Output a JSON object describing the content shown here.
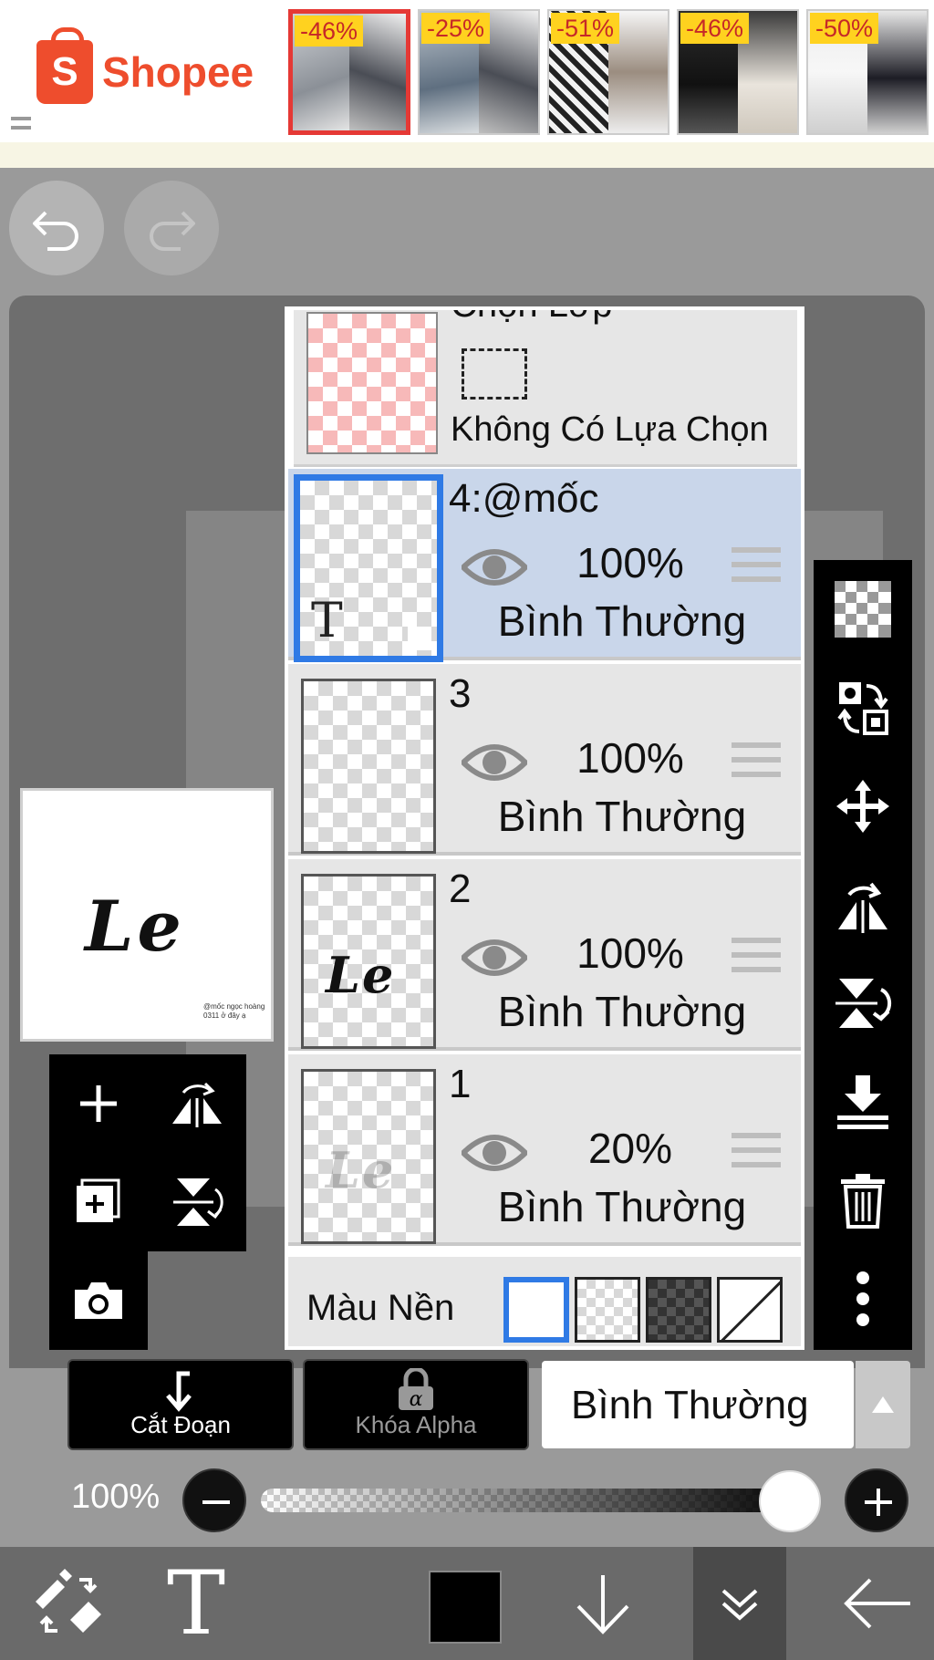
{
  "ad": {
    "brand": "Shopee",
    "products": [
      {
        "discount": "-46%"
      },
      {
        "discount": "-25%"
      },
      {
        "discount": "-51%"
      },
      {
        "discount": "-46%"
      },
      {
        "discount": "-50%"
      }
    ]
  },
  "preview": {
    "artwork_text": "Le",
    "tiny_text": "@mốc ngọc hoàng 0311 ở đây ạ"
  },
  "selection": {
    "title": "Chọn Lớp",
    "status": "Không Có Lựa Chọn"
  },
  "layers": [
    {
      "name": "4:@mốc",
      "opacity": "100%",
      "mode": "Bình Thường",
      "active": true,
      "content": "text"
    },
    {
      "name": "3",
      "opacity": "100%",
      "mode": "Bình Thường",
      "active": false,
      "content": "empty"
    },
    {
      "name": "2",
      "opacity": "100%",
      "mode": "Bình Thường",
      "active": false,
      "content": "script"
    },
    {
      "name": "1",
      "opacity": "20%",
      "mode": "Bình Thường",
      "active": false,
      "content": "script-faint"
    }
  ],
  "layer_thumb": {
    "text_icon": "T",
    "script_text": "Le"
  },
  "background": {
    "label": "Màu Nền",
    "options": [
      "white",
      "transparent",
      "dark-checker",
      "none"
    ],
    "selected": "white"
  },
  "buttons": {
    "clipping": "Cắt Đoạn",
    "alpha_lock": "Khóa Alpha"
  },
  "blend_mode": "Bình Thường",
  "opacity": {
    "label": "100%",
    "value": 1.0
  },
  "bottom_bar": {
    "text_tool": "T"
  },
  "colors": {
    "accent": "#2f7ae5",
    "brand": "#ee4d2d",
    "discount_badge": "#ffd21f"
  }
}
